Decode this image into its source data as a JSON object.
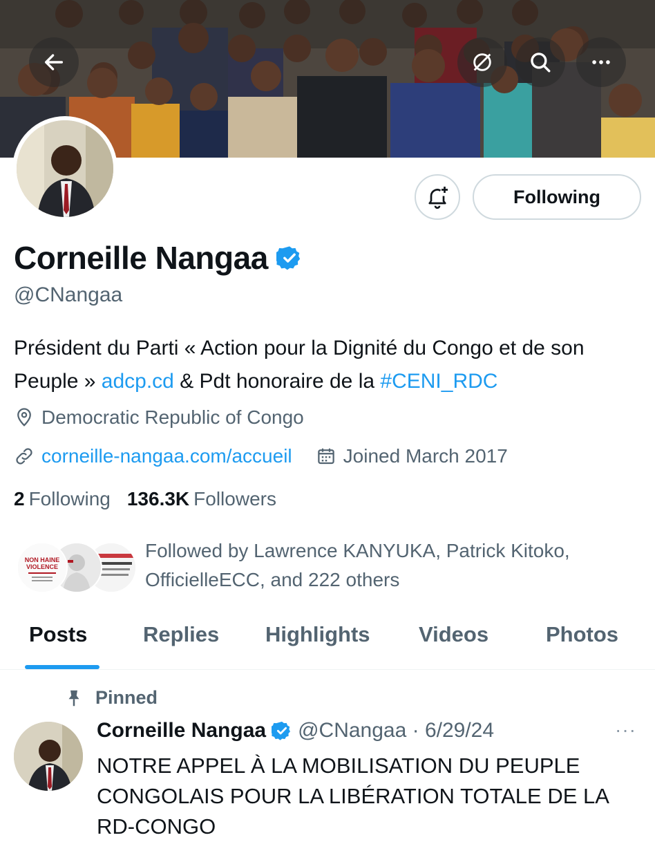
{
  "profile": {
    "name": "Corneille Nangaa",
    "handle": "@CNangaa",
    "bio_part1": "Président du Parti « Action pour la Dignité du Congo et de son Peuple »",
    "bio_link1": "adcp.cd",
    "bio_part2": "& Pdt honoraire de la",
    "bio_hashtag": "#CENI_RDC",
    "location": "Democratic Republic of Congo",
    "website": "corneille-nangaa.com/accueil",
    "joined": "Joined March 2017",
    "following_count": "2",
    "following_label": "Following",
    "followers_count": "136.3K",
    "followers_label": "Followers",
    "followed_by": "Followed by Lawrence KANYUKA, Patrick Kitoko, OfficielleECC, and 222 others",
    "follower_avatar_1_text": "NON HAINE VIOLENCE"
  },
  "actions": {
    "following_button": "Following"
  },
  "tabs": [
    "Posts",
    "Replies",
    "Highlights",
    "Videos",
    "Photos"
  ],
  "pinned_post": {
    "pinned_label": "Pinned",
    "author": "Corneille Nangaa",
    "handle_date": "@CNangaa · 6/29/24",
    "more": "···",
    "text": "NOTRE APPEL À LA MOBILISATION DU PEUPLE CONGOLAIS POUR LA LIBÉRATION TOTALE DE LA RD-CONGO"
  },
  "icons": {
    "back": "arrow-left-icon",
    "hide": "eye-slash-icon",
    "search": "search-icon",
    "more": "more-icon",
    "notify": "bell-plus-icon",
    "verified": "verified-badge-icon",
    "location": "location-pin-icon",
    "link": "link-icon",
    "calendar": "calendar-icon",
    "pin": "pin-icon"
  },
  "colors": {
    "accent": "#1d9bf0",
    "text": "#0f1419",
    "secondary": "#536471"
  }
}
